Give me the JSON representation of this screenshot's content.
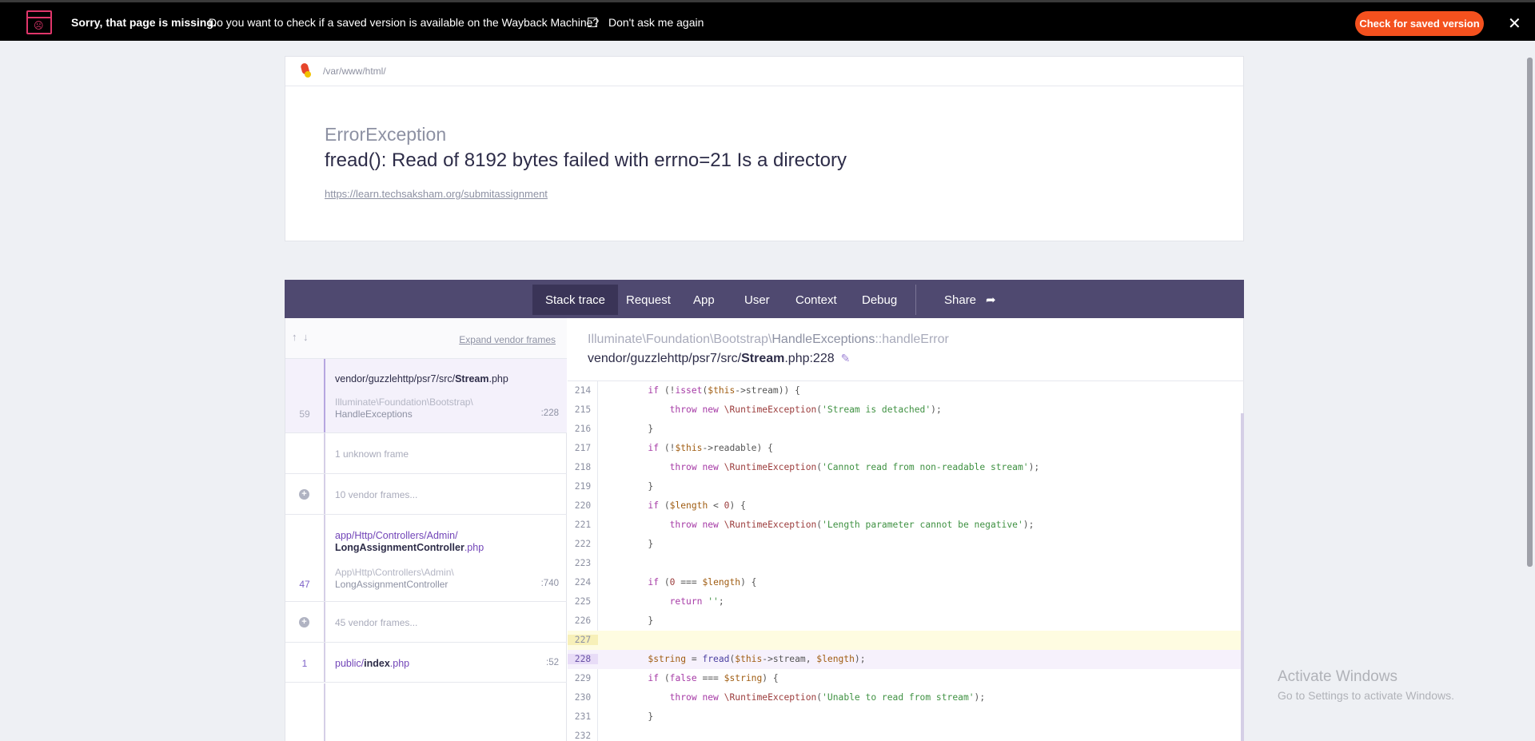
{
  "wayback": {
    "message_strong": "Sorry, that page is missing.",
    "message": "Do you want to check if a saved version is available on the Wayback Machine?",
    "checkbox_label": "Don't ask me again",
    "button_label": "Check for saved version",
    "close_glyph": "✕",
    "face_glyph": "☹",
    "accent_color": "#f4511e"
  },
  "header": {
    "path": "/var/www/html/",
    "exception_class": "ErrorException",
    "exception_message": "fread(): Read of 8192 bytes failed with errno=21 Is a directory",
    "url": "https://learn.techsaksham.org/submitassignment"
  },
  "tabs": {
    "items": [
      "Stack trace",
      "Request",
      "App",
      "User",
      "Context",
      "Debug"
    ],
    "share_label": "Share",
    "active": "Stack trace"
  },
  "frames_panel": {
    "expand_label": "Expand vendor frames",
    "frames": [
      {
        "number": "59",
        "file_prefix": "vendor/guzzlehttp/psr7/src/",
        "file_name": "Stream",
        "file_ext": ".php",
        "namespace": "Illuminate\\Foundation\\Bootstrap\\",
        "class": "HandleExceptions",
        "line": ":228"
      },
      {
        "unknown_label": "1 unknown frame"
      },
      {
        "vendor_label": "10 vendor frames..."
      },
      {
        "number": "47",
        "file_prefix": "app/Http/Controllers/Admin/",
        "file_name": "LongAssignmentController",
        "file_ext": ".php",
        "namespace": "App\\Http\\Controllers\\Admin\\",
        "class": "LongAssignmentController",
        "line": ":740"
      },
      {
        "vendor_label": "45 vendor frames..."
      },
      {
        "number": "1",
        "file_prefix": "public/",
        "file_name": "index",
        "file_ext": ".php",
        "line": ":52"
      }
    ]
  },
  "code_view": {
    "class_prefix": "Illuminate\\Foundation\\Bootstrap\\",
    "class_name": "HandleExceptions",
    "method": "::handleError",
    "file_prefix": "vendor/guzzlehttp/psr7/src/",
    "file_name": "Stream",
    "file_suffix": ".php:228",
    "lines": [
      {
        "n": "214",
        "code": "        if (!isset($this->stream)) {"
      },
      {
        "n": "215",
        "code": "            throw new \\RuntimeException('Stream is detached');"
      },
      {
        "n": "216",
        "code": "        }"
      },
      {
        "n": "217",
        "code": "        if (!$this->readable) {"
      },
      {
        "n": "218",
        "code": "            throw new \\RuntimeException('Cannot read from non-readable stream');"
      },
      {
        "n": "219",
        "code": "        }"
      },
      {
        "n": "220",
        "code": "        if ($length < 0) {"
      },
      {
        "n": "221",
        "code": "            throw new \\RuntimeException('Length parameter cannot be negative');"
      },
      {
        "n": "222",
        "code": "        }"
      },
      {
        "n": "223",
        "code": ""
      },
      {
        "n": "224",
        "code": "        if (0 === $length) {"
      },
      {
        "n": "225",
        "code": "            return '';"
      },
      {
        "n": "226",
        "code": "        }"
      },
      {
        "n": "227",
        "code": ""
      },
      {
        "n": "228",
        "code": "        $string = fread($this->stream, $length);"
      },
      {
        "n": "229",
        "code": "        if (false === $string) {"
      },
      {
        "n": "230",
        "code": "            throw new \\RuntimeException('Unable to read from stream');"
      },
      {
        "n": "231",
        "code": "        }"
      },
      {
        "n": "232",
        "code": ""
      }
    ]
  },
  "watermark": {
    "title": "Activate Windows",
    "subtitle": "Go to Settings to activate Windows."
  }
}
